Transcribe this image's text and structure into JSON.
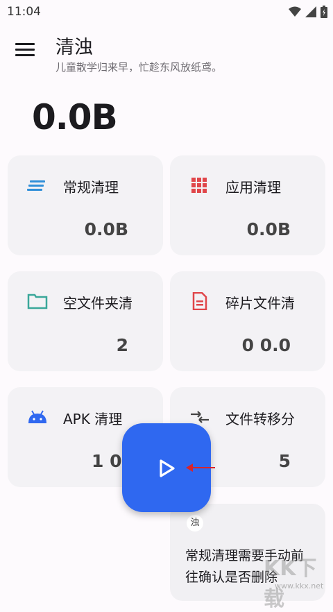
{
  "status": {
    "time": "11:04"
  },
  "header": {
    "title": "清浊",
    "subtitle": "儿童散学归来早，忙趁东风放纸鸢。"
  },
  "total_size": "0.0B",
  "cards": [
    {
      "label": "常规清理",
      "value": "0.0B",
      "icon": "lines-icon",
      "color": "#2f8fd8"
    },
    {
      "label": "应用清理",
      "value": "0.0B",
      "icon": "grid-icon",
      "color": "#e0464a"
    },
    {
      "label": "空文件夹清",
      "value": "2",
      "icon": "folder-icon",
      "color": "#3aa79a"
    },
    {
      "label": "碎片文件清",
      "value": "0 0.0",
      "icon": "document-icon",
      "color": "#e0464a"
    },
    {
      "label": "APK 清理",
      "value": "1 0.",
      "icon": "android-icon",
      "color": "#2f68f0"
    },
    {
      "label": "文件转移分",
      "value": "5",
      "icon": "transfer-icon",
      "color": "#444444"
    }
  ],
  "tip": {
    "avatar": "浊",
    "text": "常规清理需要手动前往确认是否删除"
  },
  "watermark": {
    "logo": "KK下载",
    "url": "www.kkx.net"
  }
}
